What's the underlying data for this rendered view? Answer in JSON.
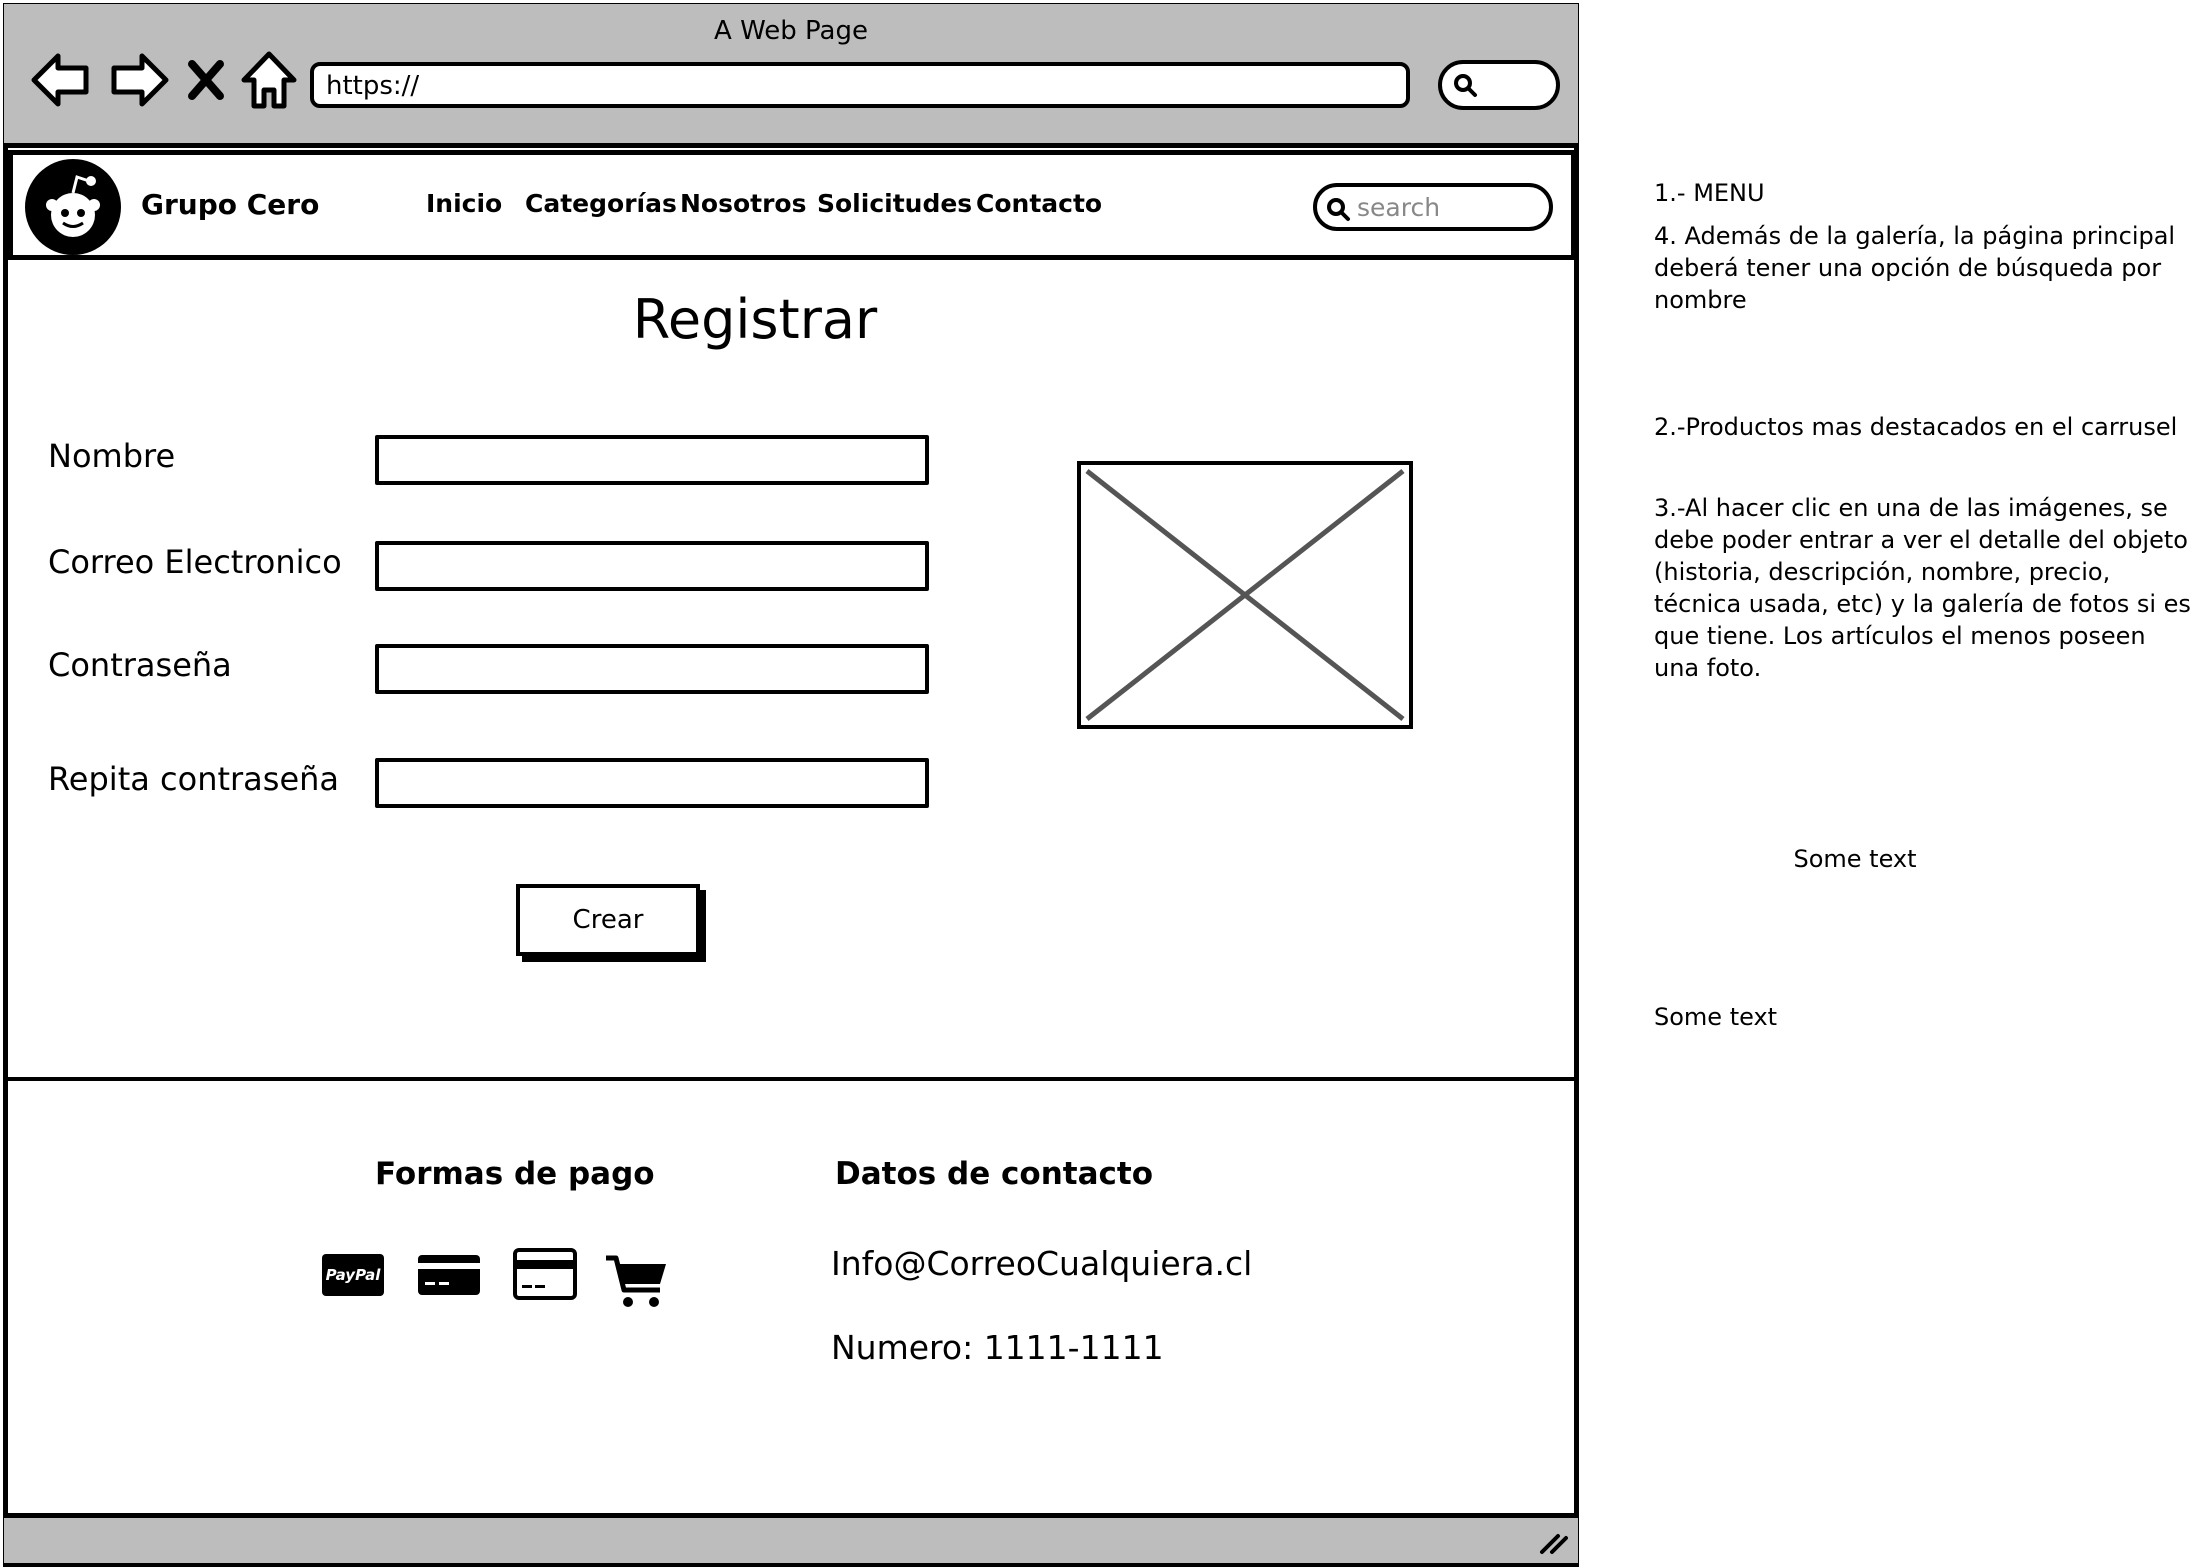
{
  "window": {
    "title": "A Web Page",
    "url": "https://"
  },
  "header": {
    "brand": "Grupo Cero",
    "menu": [
      "Inicio",
      "Categorías",
      "Nosotros",
      "Solicitudes",
      "Contacto"
    ],
    "search_placeholder": "search"
  },
  "form": {
    "title": "Registrar",
    "fields": [
      {
        "label": "Nombre",
        "value": ""
      },
      {
        "label": "Correo Electronico",
        "value": ""
      },
      {
        "label": "Contraseña",
        "value": ""
      },
      {
        "label": "Repita contraseña",
        "value": ""
      }
    ],
    "submit_label": "Crear"
  },
  "footer": {
    "payment_heading": "Formas de pago",
    "payment_icons": [
      "paypal-icon",
      "credit-card-icon",
      "debit-card-icon",
      "shopping-cart-icon"
    ],
    "paypal_text": "PayPal",
    "contact_heading": "Datos de contacto",
    "email": "Info@CorreoCualquiera.cl",
    "phone": "Numero: 1111-1111"
  },
  "notes": {
    "menu": "1.- MENU",
    "search": "4. Además de la galería, la página principal deberá tener una opción de búsqueda por nombre",
    "carousel": "2.-Productos mas destacados en el carrusel",
    "detail": "3.-Al hacer clic en una de las imágenes, se debe poder entrar a ver el detalle del objeto (historia, descripción, nombre, precio, técnica usada, etc) y la galería de fotos si es que tiene. Los artículos el menos poseen una foto.",
    "text_a": "Some text",
    "text_b": "Some text"
  }
}
